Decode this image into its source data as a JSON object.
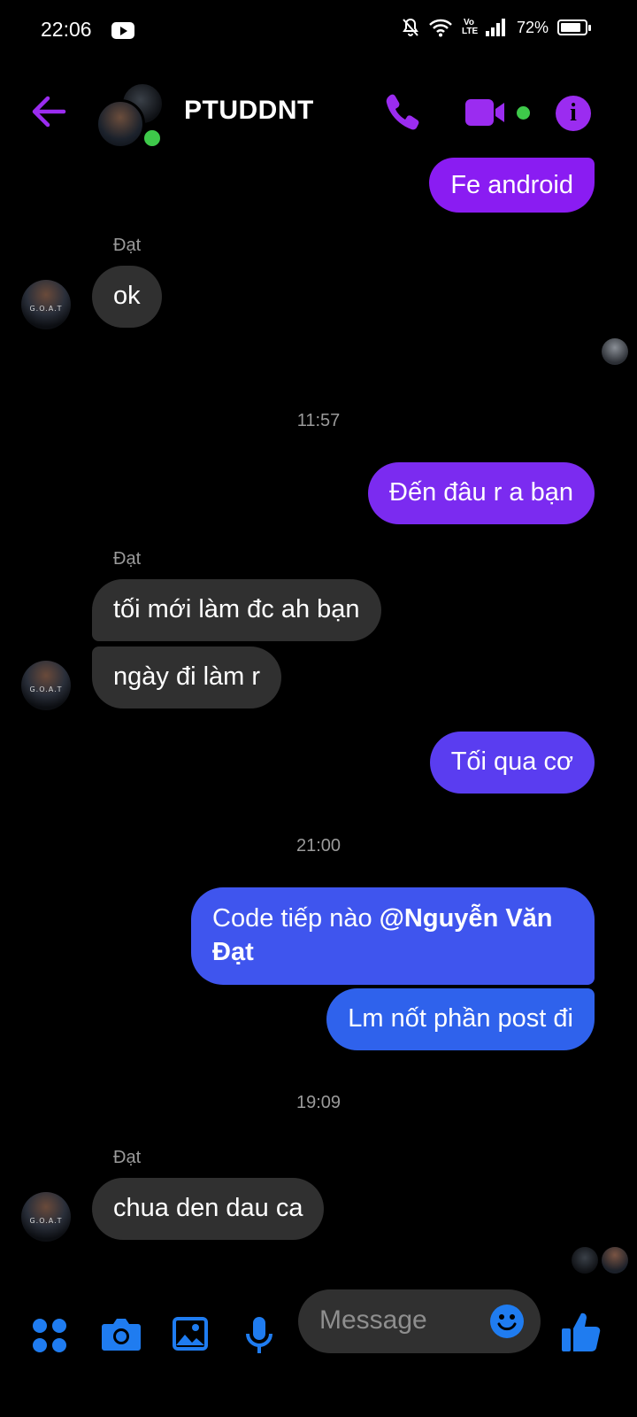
{
  "status_bar": {
    "time": "22:06",
    "battery": "72%",
    "battery_level": 0.72,
    "network": "Vo LTE"
  },
  "header": {
    "title": "PTUDDNT"
  },
  "messages": {
    "m1": "Fe android",
    "sender1": "Đạt",
    "m2": "ok",
    "time1": "11:57",
    "m3": "Đến đâu r a bạn",
    "sender2": "Đạt",
    "m4": "tối mới làm đc ah bạn",
    "m5": "ngày đi làm r",
    "m6": "Tối qua cơ",
    "time2": "21:00",
    "m7_text": "Code tiếp nào ",
    "m7_mention_line1": "@Nguyễn Văn",
    "m7_mention_line2": "Đạt",
    "m8": "Lm nốt phần post đi",
    "time3": "19:09",
    "sender3": "Đạt",
    "m9": "chua den dau ca"
  },
  "composer": {
    "placeholder": "Message"
  },
  "colors": {
    "accent": "#9b2cf0",
    "composer_icons": "#1f7cf0",
    "incoming_bubble": "#303030",
    "online": "#3ec94a"
  }
}
